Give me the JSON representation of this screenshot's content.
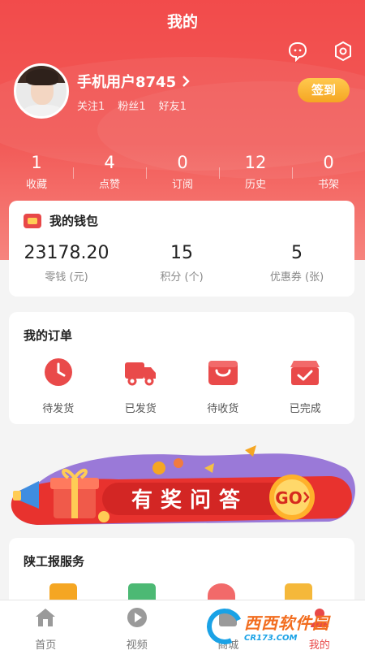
{
  "header": {
    "title": "我的",
    "icons": [
      "message-icon",
      "settings-icon"
    ],
    "username": "手机用户8745",
    "stats": [
      {
        "label": "关注",
        "value": "1"
      },
      {
        "label": "粉丝",
        "value": "1"
      },
      {
        "label": "好友",
        "value": "1"
      }
    ],
    "signin_label": "签到",
    "counts": [
      {
        "value": "1",
        "label": "收藏"
      },
      {
        "value": "4",
        "label": "点赞"
      },
      {
        "value": "0",
        "label": "订阅"
      },
      {
        "value": "12",
        "label": "历史"
      },
      {
        "value": "0",
        "label": "书架"
      }
    ]
  },
  "wallet": {
    "title": "我的钱包",
    "items": [
      {
        "value": "23178.20",
        "label": "零钱 (元)"
      },
      {
        "value": "15",
        "label": "积分 (个)"
      },
      {
        "value": "5",
        "label": "优惠券 (张)"
      }
    ]
  },
  "orders": {
    "title": "我的订单",
    "items": [
      {
        "label": "待发货",
        "icon": "clock-icon"
      },
      {
        "label": "已发货",
        "icon": "truck-icon"
      },
      {
        "label": "待收货",
        "icon": "bag-icon"
      },
      {
        "label": "已完成",
        "icon": "box-check-icon"
      }
    ]
  },
  "banner": {
    "text": "有奖问答",
    "go": "GO"
  },
  "service": {
    "title": "陕工报服务"
  },
  "tabbar": {
    "items": [
      {
        "label": "首页",
        "icon": "home-icon"
      },
      {
        "label": "视频",
        "icon": "play-icon"
      },
      {
        "label": "商城",
        "icon": "shop-icon"
      },
      {
        "label": "我的",
        "icon": "user-icon",
        "active": true
      }
    ]
  },
  "watermark": {
    "main": "西西软件园",
    "sub": "CR173.COM"
  },
  "colors": {
    "brand": "#f24b4b",
    "accent_gold": "#f5a623",
    "active_tab": "#e84848"
  }
}
